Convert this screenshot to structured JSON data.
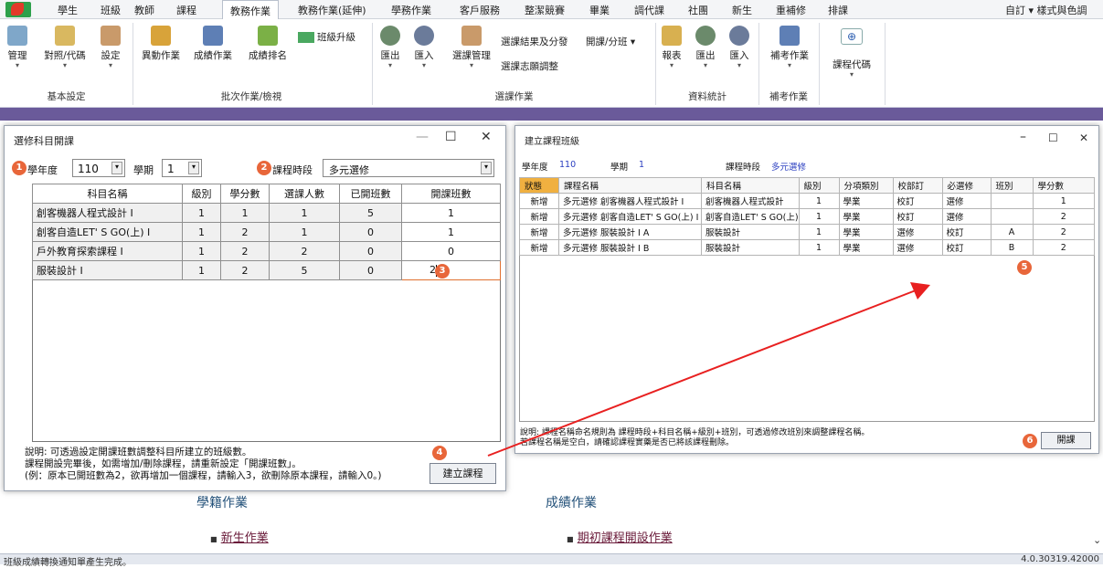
{
  "menu": [
    "學生",
    "班級",
    "教師",
    "課程",
    "教務作業",
    "教務作業(延伸)",
    "學務作業",
    "客戶服務",
    "整潔競賽",
    "畢業",
    "調代課",
    "社團",
    "新生",
    "重補修",
    "排課"
  ],
  "menu_right": "自訂 ▾ 樣式與色調",
  "ribbon": {
    "buttons": [
      "管理",
      "對照/代碼",
      "設定",
      "異動作業",
      "成績作業",
      "成績排名",
      "班級升級",
      "匯出",
      "匯入",
      "選課管理",
      "選課結果及分發",
      "開課/分班",
      "選課志願調整",
      "報表",
      "匯出",
      "匯入",
      "補考作業",
      "課程代碼"
    ],
    "groups": [
      "基本設定",
      "批次作業/檢視",
      "選課作業",
      "資料統計",
      "補考作業"
    ]
  },
  "left_dialog": {
    "title": "選修科目開課",
    "year_label": "學年度",
    "year_value": "110",
    "sem_label": "學期",
    "sem_value": "1",
    "period_label": "課程時段",
    "period_value": "多元選修",
    "columns": [
      "科目名稱",
      "級別",
      "學分數",
      "選課人數",
      "已開班數",
      "開課班數"
    ],
    "rows": [
      [
        "創客機器人程式設計 I",
        "1",
        "1",
        "1",
        "5",
        "1"
      ],
      [
        "創客自造LET' S GO(上) I",
        "1",
        "2",
        "1",
        "0",
        "1"
      ],
      [
        "戶外教育探索課程 I",
        "1",
        "2",
        "2",
        "0",
        "0"
      ],
      [
        "服裝設計 I",
        "1",
        "2",
        "5",
        "0",
        "2"
      ]
    ],
    "note": [
      "說明: 可透過設定開課班數調整科目所建立的班級數。",
      "課程開設完畢後，如需增加/刪除課程，請重新設定「開課班數」。",
      "(例：原本已開班數為2，欲再增加一個課程，請輸入3，欲刪除原本課程，請輸入0。)"
    ],
    "button": "建立課程"
  },
  "right_dialog": {
    "title": "建立課程班級",
    "year_label": "學年度",
    "year_value": "110",
    "sem_label": "學期",
    "sem_value": "1",
    "period_label": "課程時段",
    "period_value": "多元選修",
    "columns": [
      "狀態",
      "課程名稱",
      "科目名稱",
      "級別",
      "分項類別",
      "校部訂",
      "必選修",
      "班別",
      "學分數"
    ],
    "rows": [
      [
        "新增",
        "多元選修 創客機器人程式設計 I",
        "創客機器人程式設計",
        "1",
        "學業",
        "校訂",
        "選修",
        "",
        "1"
      ],
      [
        "新增",
        "多元選修 創客自造LET' S GO(上) I",
        "創客自造LET' S GO(上)",
        "1",
        "學業",
        "校訂",
        "選修",
        "",
        "2"
      ],
      [
        "新增",
        "多元選修 服裝設計 I A",
        "服裝設計",
        "1",
        "學業",
        "選修",
        "校訂",
        "A",
        "2"
      ],
      [
        "新增",
        "多元選修 服裝設計 I B",
        "服裝設計",
        "1",
        "學業",
        "選修",
        "校訂",
        "B",
        "2"
      ]
    ],
    "note": [
      "說明: 課程名稱命名規則為 課程時段+科目名稱+級別+班別，可透過修改班別來調整課程名稱。",
      "若課程名稱是空白，請確認課程實藥是否已將該課程刪除。"
    ],
    "button": "開課"
  },
  "markers": [
    "1",
    "2",
    "3",
    "4",
    "5",
    "6"
  ],
  "background": {
    "head1": "學籍作業",
    "head2": "成績作業",
    "link1": "新生作業",
    "link2": "期初課程開設作業"
  },
  "status": {
    "left": "班級成績轉換通知單產生完成。",
    "right": "4.0.30319.42000"
  }
}
